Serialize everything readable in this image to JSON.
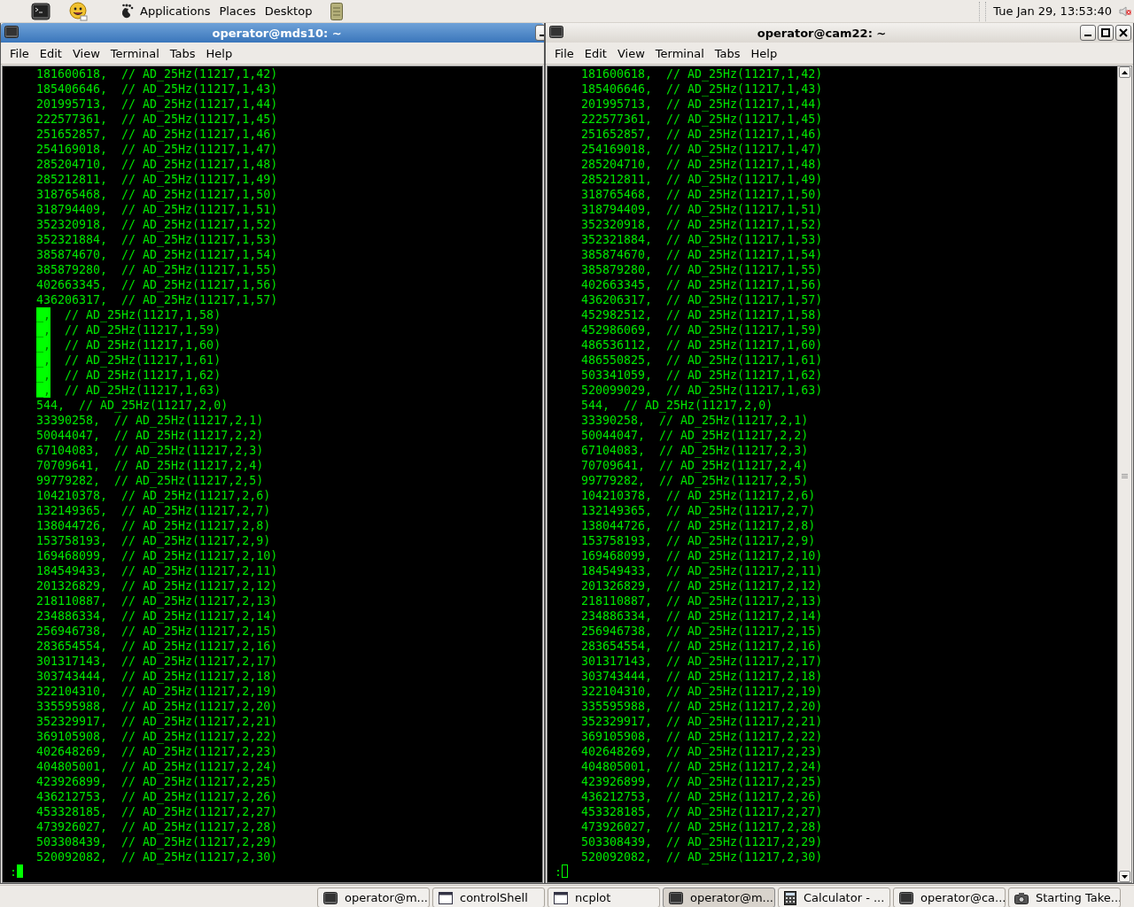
{
  "top_panel": {
    "menus": [
      "Applications",
      "Places",
      "Desktop"
    ],
    "clock": "Tue Jan 29, 13:53:40"
  },
  "windows": [
    {
      "title": "operator@mds10: ~",
      "focused": true,
      "menu": [
        "File",
        "Edit",
        "View",
        "Terminal",
        "Tabs",
        "Help"
      ],
      "prompt": ":",
      "lines": [
        {
          "kind": "plain",
          "text": "181600618,  // AD_25Hz(11217,1,42)"
        },
        {
          "kind": "plain",
          "text": "185406646,  // AD_25Hz(11217,1,43)"
        },
        {
          "kind": "plain",
          "text": "201995713,  // AD_25Hz(11217,1,44)"
        },
        {
          "kind": "plain",
          "text": "222577361,  // AD_25Hz(11217,1,45)"
        },
        {
          "kind": "plain",
          "text": "251652857,  // AD_25Hz(11217,1,46)"
        },
        {
          "kind": "plain",
          "text": "254169018,  // AD_25Hz(11217,1,47)"
        },
        {
          "kind": "plain",
          "text": "285204710,  // AD_25Hz(11217,1,48)"
        },
        {
          "kind": "plain",
          "text": "285212811,  // AD_25Hz(11217,1,49)"
        },
        {
          "kind": "plain",
          "text": "318765468,  // AD_25Hz(11217,1,50)"
        },
        {
          "kind": "plain",
          "text": "318794409,  // AD_25Hz(11217,1,51)"
        },
        {
          "kind": "plain",
          "text": "352320918,  // AD_25Hz(11217,1,52)"
        },
        {
          "kind": "plain",
          "text": "352321884,  // AD_25Hz(11217,1,53)"
        },
        {
          "kind": "plain",
          "text": "385874670,  // AD_25Hz(11217,1,54)"
        },
        {
          "kind": "plain",
          "text": "385879280,  // AD_25Hz(11217,1,55)"
        },
        {
          "kind": "plain",
          "text": "402663345,  // AD_25Hz(11217,1,56)"
        },
        {
          "kind": "plain",
          "text": "436206317,  // AD_25Hz(11217,1,57)"
        },
        {
          "kind": "marked",
          "marked": "_,",
          "text": "// AD_25Hz(11217,1,58)"
        },
        {
          "kind": "marked",
          "marked": "_,",
          "text": "// AD_25Hz(11217,1,59)"
        },
        {
          "kind": "marked",
          "marked": "_,",
          "text": "// AD_25Hz(11217,1,60)"
        },
        {
          "kind": "marked",
          "marked": "_,",
          "text": "// AD_25Hz(11217,1,61)"
        },
        {
          "kind": "marked",
          "marked": "_,",
          "text": "// AD_25Hz(11217,1,62)"
        },
        {
          "kind": "marked",
          "marked": "_,",
          "text": "// AD_25Hz(11217,1,63)"
        },
        {
          "kind": "plain",
          "text": "544,  // AD_25Hz(11217,2,0)"
        },
        {
          "kind": "plain",
          "text": "33390258,  // AD_25Hz(11217,2,1)"
        },
        {
          "kind": "plain",
          "text": "50044047,  // AD_25Hz(11217,2,2)"
        },
        {
          "kind": "plain",
          "text": "67104083,  // AD_25Hz(11217,2,3)"
        },
        {
          "kind": "plain",
          "text": "70709641,  // AD_25Hz(11217,2,4)"
        },
        {
          "kind": "plain",
          "text": "99779282,  // AD_25Hz(11217,2,5)"
        },
        {
          "kind": "plain",
          "text": "104210378,  // AD_25Hz(11217,2,6)"
        },
        {
          "kind": "plain",
          "text": "132149365,  // AD_25Hz(11217,2,7)"
        },
        {
          "kind": "plain",
          "text": "138044726,  // AD_25Hz(11217,2,8)"
        },
        {
          "kind": "plain",
          "text": "153758193,  // AD_25Hz(11217,2,9)"
        },
        {
          "kind": "plain",
          "text": "169468099,  // AD_25Hz(11217,2,10)"
        },
        {
          "kind": "plain",
          "text": "184549433,  // AD_25Hz(11217,2,11)"
        },
        {
          "kind": "plain",
          "text": "201326829,  // AD_25Hz(11217,2,12)"
        },
        {
          "kind": "plain",
          "text": "218110887,  // AD_25Hz(11217,2,13)"
        },
        {
          "kind": "plain",
          "text": "234886334,  // AD_25Hz(11217,2,14)"
        },
        {
          "kind": "plain",
          "text": "256946738,  // AD_25Hz(11217,2,15)"
        },
        {
          "kind": "plain",
          "text": "283654554,  // AD_25Hz(11217,2,16)"
        },
        {
          "kind": "plain",
          "text": "301317143,  // AD_25Hz(11217,2,17)"
        },
        {
          "kind": "plain",
          "text": "303743444,  // AD_25Hz(11217,2,18)"
        },
        {
          "kind": "plain",
          "text": "322104310,  // AD_25Hz(11217,2,19)"
        },
        {
          "kind": "plain",
          "text": "335595988,  // AD_25Hz(11217,2,20)"
        },
        {
          "kind": "plain",
          "text": "352329917,  // AD_25Hz(11217,2,21)"
        },
        {
          "kind": "plain",
          "text": "369105908,  // AD_25Hz(11217,2,22)"
        },
        {
          "kind": "plain",
          "text": "402648269,  // AD_25Hz(11217,2,23)"
        },
        {
          "kind": "plain",
          "text": "404805001,  // AD_25Hz(11217,2,24)"
        },
        {
          "kind": "plain",
          "text": "423926899,  // AD_25Hz(11217,2,25)"
        },
        {
          "kind": "plain",
          "text": "436212753,  // AD_25Hz(11217,2,26)"
        },
        {
          "kind": "plain",
          "text": "453328185,  // AD_25Hz(11217,2,27)"
        },
        {
          "kind": "plain",
          "text": "473926027,  // AD_25Hz(11217,2,28)"
        },
        {
          "kind": "plain",
          "text": "503308439,  // AD_25Hz(11217,2,29)"
        },
        {
          "kind": "plain",
          "text": "520092082,  // AD_25Hz(11217,2,30)"
        }
      ]
    },
    {
      "title": "operator@cam22: ~",
      "focused": false,
      "menu": [
        "File",
        "Edit",
        "View",
        "Terminal",
        "Tabs",
        "Help"
      ],
      "prompt": ":",
      "lines": [
        {
          "kind": "plain",
          "text": "181600618,  // AD_25Hz(11217,1,42)"
        },
        {
          "kind": "plain",
          "text": "185406646,  // AD_25Hz(11217,1,43)"
        },
        {
          "kind": "plain",
          "text": "201995713,  // AD_25Hz(11217,1,44)"
        },
        {
          "kind": "plain",
          "text": "222577361,  // AD_25Hz(11217,1,45)"
        },
        {
          "kind": "plain",
          "text": "251652857,  // AD_25Hz(11217,1,46)"
        },
        {
          "kind": "plain",
          "text": "254169018,  // AD_25Hz(11217,1,47)"
        },
        {
          "kind": "plain",
          "text": "285204710,  // AD_25Hz(11217,1,48)"
        },
        {
          "kind": "plain",
          "text": "285212811,  // AD_25Hz(11217,1,49)"
        },
        {
          "kind": "plain",
          "text": "318765468,  // AD_25Hz(11217,1,50)"
        },
        {
          "kind": "plain",
          "text": "318794409,  // AD_25Hz(11217,1,51)"
        },
        {
          "kind": "plain",
          "text": "352320918,  // AD_25Hz(11217,1,52)"
        },
        {
          "kind": "plain",
          "text": "352321884,  // AD_25Hz(11217,1,53)"
        },
        {
          "kind": "plain",
          "text": "385874670,  // AD_25Hz(11217,1,54)"
        },
        {
          "kind": "plain",
          "text": "385879280,  // AD_25Hz(11217,1,55)"
        },
        {
          "kind": "plain",
          "text": "402663345,  // AD_25Hz(11217,1,56)"
        },
        {
          "kind": "plain",
          "text": "436206317,  // AD_25Hz(11217,1,57)"
        },
        {
          "kind": "plain",
          "text": "452982512,  // AD_25Hz(11217,1,58)"
        },
        {
          "kind": "plain",
          "text": "452986069,  // AD_25Hz(11217,1,59)"
        },
        {
          "kind": "plain",
          "text": "486536112,  // AD_25Hz(11217,1,60)"
        },
        {
          "kind": "plain",
          "text": "486550825,  // AD_25Hz(11217,1,61)"
        },
        {
          "kind": "plain",
          "text": "503341059,  // AD_25Hz(11217,1,62)"
        },
        {
          "kind": "plain",
          "text": "520099029,  // AD_25Hz(11217,1,63)"
        },
        {
          "kind": "plain",
          "text": "544,  // AD_25Hz(11217,2,0)"
        },
        {
          "kind": "plain",
          "text": "33390258,  // AD_25Hz(11217,2,1)"
        },
        {
          "kind": "plain",
          "text": "50044047,  // AD_25Hz(11217,2,2)"
        },
        {
          "kind": "plain",
          "text": "67104083,  // AD_25Hz(11217,2,3)"
        },
        {
          "kind": "plain",
          "text": "70709641,  // AD_25Hz(11217,2,4)"
        },
        {
          "kind": "plain",
          "text": "99779282,  // AD_25Hz(11217,2,5)"
        },
        {
          "kind": "plain",
          "text": "104210378,  // AD_25Hz(11217,2,6)"
        },
        {
          "kind": "plain",
          "text": "132149365,  // AD_25Hz(11217,2,7)"
        },
        {
          "kind": "plain",
          "text": "138044726,  // AD_25Hz(11217,2,8)"
        },
        {
          "kind": "plain",
          "text": "153758193,  // AD_25Hz(11217,2,9)"
        },
        {
          "kind": "plain",
          "text": "169468099,  // AD_25Hz(11217,2,10)"
        },
        {
          "kind": "plain",
          "text": "184549433,  // AD_25Hz(11217,2,11)"
        },
        {
          "kind": "plain",
          "text": "201326829,  // AD_25Hz(11217,2,12)"
        },
        {
          "kind": "plain",
          "text": "218110887,  // AD_25Hz(11217,2,13)"
        },
        {
          "kind": "plain",
          "text": "234886334,  // AD_25Hz(11217,2,14)"
        },
        {
          "kind": "plain",
          "text": "256946738,  // AD_25Hz(11217,2,15)"
        },
        {
          "kind": "plain",
          "text": "283654554,  // AD_25Hz(11217,2,16)"
        },
        {
          "kind": "plain",
          "text": "301317143,  // AD_25Hz(11217,2,17)"
        },
        {
          "kind": "plain",
          "text": "303743444,  // AD_25Hz(11217,2,18)"
        },
        {
          "kind": "plain",
          "text": "322104310,  // AD_25Hz(11217,2,19)"
        },
        {
          "kind": "plain",
          "text": "335595988,  // AD_25Hz(11217,2,20)"
        },
        {
          "kind": "plain",
          "text": "352329917,  // AD_25Hz(11217,2,21)"
        },
        {
          "kind": "plain",
          "text": "369105908,  // AD_25Hz(11217,2,22)"
        },
        {
          "kind": "plain",
          "text": "402648269,  // AD_25Hz(11217,2,23)"
        },
        {
          "kind": "plain",
          "text": "404805001,  // AD_25Hz(11217,2,24)"
        },
        {
          "kind": "plain",
          "text": "423926899,  // AD_25Hz(11217,2,25)"
        },
        {
          "kind": "plain",
          "text": "436212753,  // AD_25Hz(11217,2,26)"
        },
        {
          "kind": "plain",
          "text": "453328185,  // AD_25Hz(11217,2,27)"
        },
        {
          "kind": "plain",
          "text": "473926027,  // AD_25Hz(11217,2,28)"
        },
        {
          "kind": "plain",
          "text": "503308439,  // AD_25Hz(11217,2,29)"
        },
        {
          "kind": "plain",
          "text": "520092082,  // AD_25Hz(11217,2,30)"
        }
      ]
    }
  ],
  "taskbar": [
    {
      "kind": "terminal",
      "label": "operator@m...",
      "selected": false
    },
    {
      "kind": "window",
      "label": "controlShell",
      "selected": false
    },
    {
      "kind": "window",
      "label": "ncplot",
      "selected": false
    },
    {
      "kind": "terminal",
      "label": "operator@m...",
      "selected": true
    },
    {
      "kind": "calculator",
      "label": "Calculator  - ...",
      "selected": false
    },
    {
      "kind": "terminal",
      "label": "operator@ca...",
      "selected": false
    },
    {
      "kind": "camera",
      "label": "Starting Take...",
      "selected": false
    }
  ]
}
